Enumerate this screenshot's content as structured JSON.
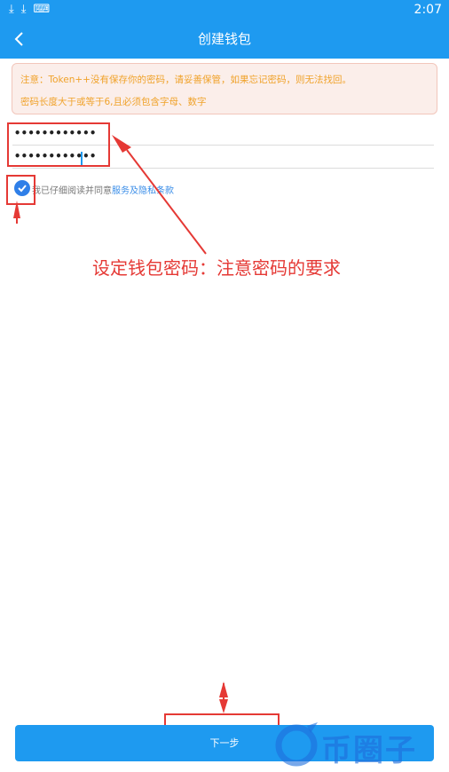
{
  "status_bar": {
    "time": "2:07",
    "icons": [
      "download-icon",
      "download-icon",
      "keyboard-icon"
    ]
  },
  "header": {
    "title": "创建钱包",
    "back_icon": "chevron-left-icon"
  },
  "notice": {
    "line1": "注意：Token++没有保存你的密码，请妥善保管，如果忘记密码，则无法找回。",
    "line2": "密码长度大于或等于6,且必须包含字母、数字"
  },
  "password": {
    "value": "••••••••••••",
    "confirm_value": "••••••••••••"
  },
  "agreement": {
    "prefix": "我已仔细阅读并同意",
    "link": "服务及隐私条款",
    "checked": true
  },
  "annotation": {
    "text": "设定钱包密码：注意密码的要求"
  },
  "next_button": {
    "label": "下一步"
  },
  "watermark": {
    "text": "币圈子"
  },
  "colors": {
    "primary": "#1e9af0",
    "annotation": "#e53935",
    "notice_text": "#f0a22a",
    "notice_bg": "#fbeeea"
  }
}
